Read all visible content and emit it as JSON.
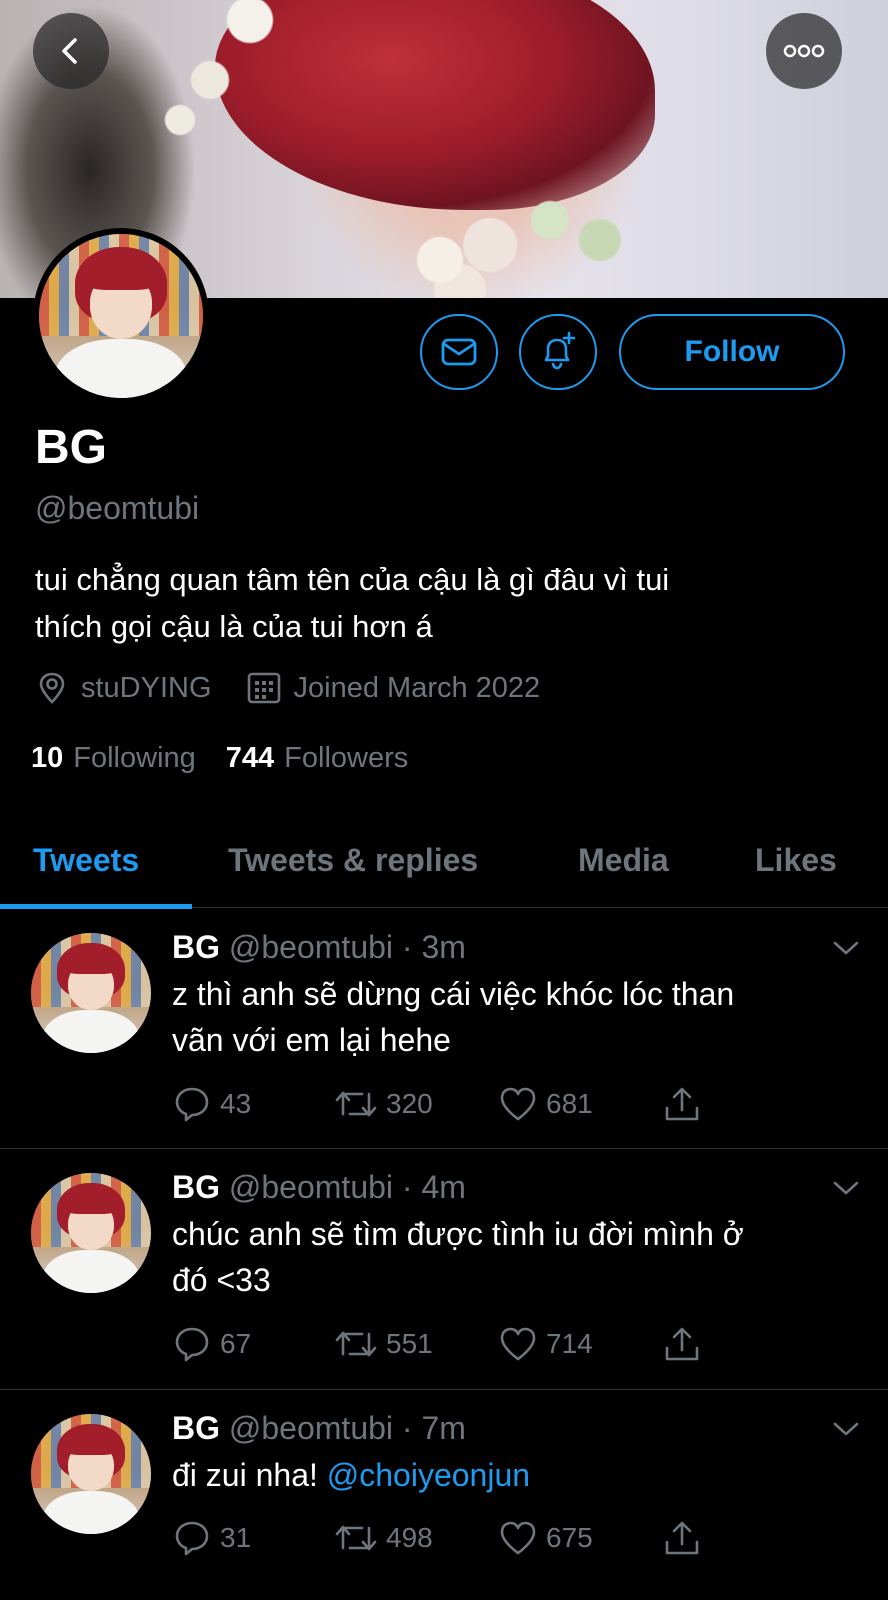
{
  "header": {
    "back_icon": "chevron-left-icon",
    "more_icon": "more-horizontal-icon"
  },
  "profile": {
    "name": "BG",
    "handle": "@beomtubi",
    "bio_line1": "tui chẳng quan tâm tên của cậu là gì đâu vì tui",
    "bio_line2": "thích gọi cậu là của tui hơn á",
    "location": "stuDYING",
    "joined": "Joined March 2022",
    "following_count": "10",
    "following_label": "Following",
    "followers_count": "744",
    "followers_label": "Followers"
  },
  "actions": {
    "follow_label": "Follow",
    "message_icon": "mail-icon",
    "notify_icon": "bell-plus-icon"
  },
  "tabs": [
    {
      "label": "Tweets",
      "active": true
    },
    {
      "label": "Tweets & replies",
      "active": false
    },
    {
      "label": "Media",
      "active": false
    },
    {
      "label": "Likes",
      "active": false
    }
  ],
  "tweets": [
    {
      "name": "BG",
      "handle": "@beomtubi",
      "time": "3m",
      "line1": "z thì anh sẽ dừng cái việc khóc lóc than",
      "line2": "vãn với em lại hehe",
      "replies": "43",
      "retweets": "320",
      "likes": "681"
    },
    {
      "name": "BG",
      "handle": "@beomtubi",
      "time": "4m",
      "line1": "chúc anh sẽ tìm được tình iu đời mình ở",
      "line2": "đó <33",
      "replies": "67",
      "retweets": "551",
      "likes": "714"
    },
    {
      "name": "BG",
      "handle": "@beomtubi",
      "time": "7m",
      "text": "đi zui nha!",
      "mention": "@choiyeonjun",
      "replies": "31",
      "retweets": "498",
      "likes": "675"
    }
  ],
  "colors": {
    "accent": "#1d9bf0",
    "muted": "#6e767d",
    "background": "#000000",
    "divider": "#2f3336"
  }
}
